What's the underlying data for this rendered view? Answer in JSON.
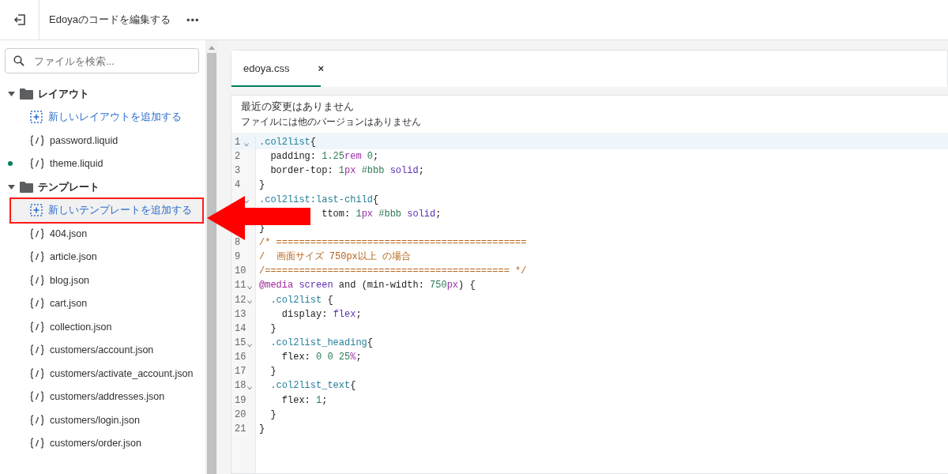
{
  "topbar": {
    "title": "Edoyaのコードを編集する",
    "more": "•••"
  },
  "sidebar": {
    "search": {
      "placeholder": "ファイルを検索..."
    },
    "tree": [
      {
        "kind": "folder",
        "label": "レイアウト",
        "expanded": true,
        "children": [
          {
            "kind": "add",
            "label": "新しいレイアウトを追加する",
            "selected": false,
            "outlined": false
          },
          {
            "kind": "file",
            "label": "password.liquid",
            "selected": false,
            "modified": false
          },
          {
            "kind": "file",
            "label": "theme.liquid",
            "selected": false,
            "modified": true
          }
        ]
      },
      {
        "kind": "folder",
        "label": "テンプレート",
        "expanded": true,
        "children": [
          {
            "kind": "add",
            "label": "新しいテンプレートを追加する",
            "selected": true,
            "outlined": true
          },
          {
            "kind": "file",
            "label": "404.json",
            "selected": false,
            "modified": false
          },
          {
            "kind": "file",
            "label": "article.json",
            "selected": false,
            "modified": false
          },
          {
            "kind": "file",
            "label": "blog.json",
            "selected": false,
            "modified": false
          },
          {
            "kind": "file",
            "label": "cart.json",
            "selected": false,
            "modified": false
          },
          {
            "kind": "file",
            "label": "collection.json",
            "selected": false,
            "modified": false
          },
          {
            "kind": "file",
            "label": "customers/account.json",
            "selected": false,
            "modified": false
          },
          {
            "kind": "file",
            "label": "customers/activate_account.json",
            "selected": false,
            "modified": false
          },
          {
            "kind": "file",
            "label": "customers/addresses.json",
            "selected": false,
            "modified": false
          },
          {
            "kind": "file",
            "label": "customers/login.json",
            "selected": false,
            "modified": false
          },
          {
            "kind": "file",
            "label": "customers/order.json",
            "selected": false,
            "modified": false
          }
        ]
      }
    ]
  },
  "editor": {
    "tabs": [
      {
        "label": "edoya.css",
        "close": "×",
        "selected": true
      }
    ],
    "notice": [
      "最近の変更はありません",
      "ファイルには他のバージョンはありません"
    ],
    "lines": [
      {
        "kind": "code",
        "number": "1",
        "foldable": true,
        "current": true,
        "tokens": [
          {
            "kind": "sel",
            "text": ".col2list"
          },
          {
            "kind": "p",
            "text": "{"
          }
        ]
      },
      {
        "kind": "code",
        "number": "2",
        "foldable": false,
        "current": false,
        "tokens": [
          {
            "kind": "p",
            "text": "  padding: "
          },
          {
            "kind": "num",
            "text": "1.25"
          },
          {
            "kind": "unit",
            "text": "rem"
          },
          {
            "kind": "num",
            "text": " 0"
          },
          {
            "kind": "p",
            "text": ";"
          }
        ]
      },
      {
        "kind": "code",
        "number": "3",
        "foldable": false,
        "current": false,
        "tokens": [
          {
            "kind": "p",
            "text": "  border-top: "
          },
          {
            "kind": "num",
            "text": "1"
          },
          {
            "kind": "unit",
            "text": "px"
          },
          {
            "kind": "num",
            "text": " #bbb"
          },
          {
            "kind": "kw",
            "text": " solid"
          },
          {
            "kind": "p",
            "text": ";"
          }
        ]
      },
      {
        "kind": "code",
        "number": "4",
        "foldable": false,
        "current": false,
        "tokens": [
          {
            "kind": "p",
            "text": "}"
          }
        ]
      },
      {
        "kind": "code",
        "foldable": true,
        "current": false,
        "tokens": [
          {
            "kind": "sel",
            "text": ".col2list:last-child"
          },
          {
            "kind": "p",
            "text": "{"
          }
        ]
      },
      {
        "kind": "covered",
        "foldable": false,
        "current": false,
        "tokens": [
          {
            "kind": "p",
            "text": "ttom: "
          },
          {
            "kind": "num",
            "text": "1"
          },
          {
            "kind": "unit",
            "text": "px"
          },
          {
            "kind": "num",
            "text": " #bbb"
          },
          {
            "kind": "kw",
            "text": " solid"
          },
          {
            "kind": "p",
            "text": ";"
          }
        ]
      },
      {
        "kind": "code",
        "foldable": false,
        "current": false,
        "tokens": [
          {
            "kind": "p",
            "text": "}"
          }
        ]
      },
      {
        "kind": "code",
        "number": "8",
        "foldable": false,
        "current": false,
        "tokens": [
          {
            "kind": "com",
            "text": "/* ============================================"
          }
        ]
      },
      {
        "kind": "code",
        "number": "9",
        "foldable": false,
        "current": false,
        "tokens": [
          {
            "kind": "com",
            "text": "/  画面サイズ 750px以上 の場合"
          }
        ]
      },
      {
        "kind": "code",
        "number": "10",
        "foldable": false,
        "current": false,
        "tokens": [
          {
            "kind": "com",
            "text": "/=========================================== */"
          }
        ]
      },
      {
        "kind": "code",
        "number": "11",
        "foldable": true,
        "current": false,
        "tokens": [
          {
            "kind": "at",
            "text": "@media"
          },
          {
            "kind": "kw",
            "text": " screen"
          },
          {
            "kind": "p",
            "text": " and (min-width: "
          },
          {
            "kind": "num",
            "text": "750"
          },
          {
            "kind": "unit",
            "text": "px"
          },
          {
            "kind": "p",
            "text": ") {"
          }
        ]
      },
      {
        "kind": "code",
        "number": "12",
        "foldable": true,
        "current": false,
        "tokens": [
          {
            "kind": "sel",
            "text": "  .col2list"
          },
          {
            "kind": "p",
            "text": " {"
          }
        ]
      },
      {
        "kind": "code",
        "number": "13",
        "foldable": false,
        "current": false,
        "tokens": [
          {
            "kind": "p",
            "text": "    display: "
          },
          {
            "kind": "kw",
            "text": "flex"
          },
          {
            "kind": "p",
            "text": ";"
          }
        ]
      },
      {
        "kind": "code",
        "number": "14",
        "foldable": false,
        "current": false,
        "tokens": [
          {
            "kind": "p",
            "text": "  }"
          }
        ]
      },
      {
        "kind": "code",
        "number": "15",
        "foldable": true,
        "current": false,
        "tokens": [
          {
            "kind": "sel",
            "text": "  .col2list_heading"
          },
          {
            "kind": "p",
            "text": "{"
          }
        ]
      },
      {
        "kind": "code",
        "number": "16",
        "foldable": false,
        "current": false,
        "tokens": [
          {
            "kind": "p",
            "text": "    flex: "
          },
          {
            "kind": "num",
            "text": "0"
          },
          {
            "kind": "num",
            "text": " 0"
          },
          {
            "kind": "num",
            "text": " 25"
          },
          {
            "kind": "unit",
            "text": "%"
          },
          {
            "kind": "p",
            "text": ";"
          }
        ]
      },
      {
        "kind": "code",
        "number": "17",
        "foldable": false,
        "current": false,
        "tokens": [
          {
            "kind": "p",
            "text": "  }"
          }
        ]
      },
      {
        "kind": "code",
        "number": "18",
        "foldable": true,
        "current": false,
        "tokens": [
          {
            "kind": "sel",
            "text": "  .col2list_text"
          },
          {
            "kind": "p",
            "text": "{"
          }
        ]
      },
      {
        "kind": "code",
        "number": "19",
        "foldable": false,
        "current": false,
        "tokens": [
          {
            "kind": "p",
            "text": "    flex: "
          },
          {
            "kind": "num",
            "text": "1"
          },
          {
            "kind": "p",
            "text": ";"
          }
        ]
      },
      {
        "kind": "code",
        "number": "20",
        "foldable": false,
        "current": false,
        "tokens": [
          {
            "kind": "p",
            "text": "  }"
          }
        ]
      },
      {
        "kind": "code",
        "number": "21",
        "foldable": false,
        "current": false,
        "tokens": [
          {
            "kind": "p",
            "text": "}"
          }
        ]
      }
    ]
  }
}
